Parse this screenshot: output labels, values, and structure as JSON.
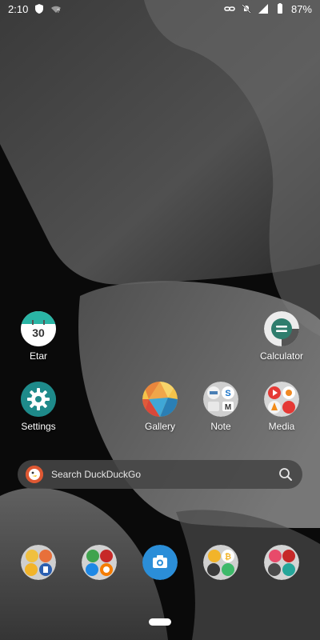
{
  "status_bar": {
    "time": "2:10",
    "battery_percent": "87%",
    "icons_left": [
      "shield-icon",
      "wifi-question-icon"
    ],
    "icons_right": [
      "link-icon",
      "notifications-off-icon",
      "signal-icon",
      "battery-icon"
    ]
  },
  "home": {
    "apps": [
      {
        "id": "etar",
        "label": "Etar",
        "icon": "calendar-icon",
        "calendar_day": "30"
      },
      {
        "id": "calculator",
        "label": "Calculator",
        "icon": "calculator-icon"
      },
      {
        "id": "settings",
        "label": "Settings",
        "icon": "gear-icon"
      },
      {
        "id": "gallery",
        "label": "Gallery",
        "icon": "gallery-icon"
      },
      {
        "id": "note",
        "label": "Note",
        "icon": "folder-icon"
      },
      {
        "id": "media",
        "label": "Media",
        "icon": "folder-icon"
      }
    ]
  },
  "search": {
    "placeholder": "Search DuckDuckGo",
    "logo_icon": "duckduckgo-icon",
    "action_icon": "search-icon"
  },
  "dock": {
    "items": [
      {
        "icon": "folder-icon"
      },
      {
        "icon": "folder-icon"
      },
      {
        "icon": "camera-icon"
      },
      {
        "icon": "folder-icon"
      },
      {
        "icon": "folder-icon"
      }
    ]
  },
  "colors": {
    "calendar_teal": "#2ab5a5",
    "settings_teal": "#1e8a8a",
    "calculator_green": "#2f7d6d",
    "camera_blue": "#2b8ed8",
    "duckduckgo_orange": "#de5833"
  }
}
